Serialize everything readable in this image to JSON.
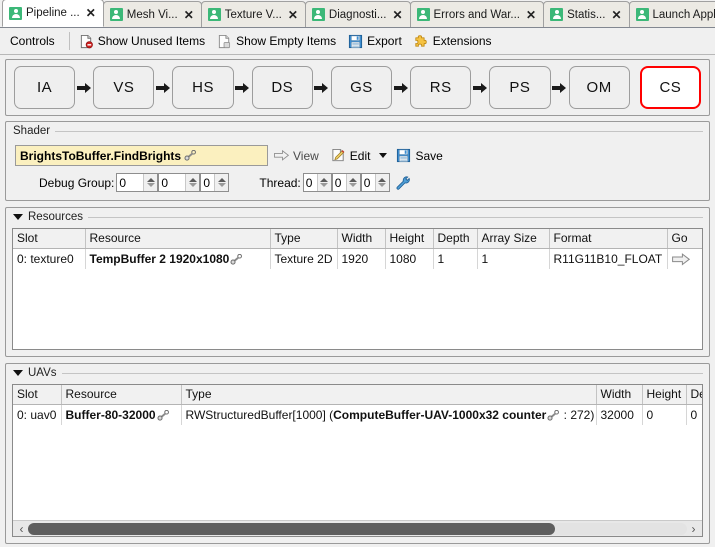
{
  "tabs": [
    {
      "label": "Pipeline ...",
      "icon": "renderdoc-tab-icon",
      "active": true
    },
    {
      "label": "Mesh Vi...",
      "icon": "renderdoc-tab-icon",
      "active": false
    },
    {
      "label": "Texture V...",
      "icon": "renderdoc-tab-icon",
      "active": false
    },
    {
      "label": "Diagnosti...",
      "icon": "renderdoc-tab-icon",
      "active": false
    },
    {
      "label": "Errors and War...",
      "icon": "renderdoc-tab-icon",
      "active": false
    },
    {
      "label": "Statis...",
      "icon": "renderdoc-tab-icon",
      "active": false
    },
    {
      "label": "Launch Appli...",
      "icon": "renderdoc-tab-icon",
      "active": false
    }
  ],
  "tab_close_glyph": "✕",
  "toolbar": {
    "controls_label": "Controls",
    "show_unused_label": "Show Unused Items",
    "show_empty_label": "Show Empty Items",
    "export_label": "Export",
    "extensions_label": "Extensions"
  },
  "pipeline": {
    "stages": [
      {
        "label": "IA",
        "selected": false
      },
      {
        "label": "VS",
        "selected": false
      },
      {
        "label": "HS",
        "selected": false
      },
      {
        "label": "DS",
        "selected": false
      },
      {
        "label": "GS",
        "selected": false
      },
      {
        "label": "RS",
        "selected": false
      },
      {
        "label": "PS",
        "selected": false
      },
      {
        "label": "OM",
        "selected": false
      },
      {
        "label": "CS",
        "selected": true
      }
    ],
    "selected_color": "#ff0000"
  },
  "shader": {
    "group_title": "Shader",
    "name": "BrightsToBuffer.FindBrights",
    "name_bg": "#fbf0bf",
    "view_label": "View",
    "edit_label": "Edit",
    "save_label": "Save",
    "debug_group_label": "Debug Group:",
    "debug_group": [
      "0",
      "0",
      "0"
    ],
    "thread_label": "Thread:",
    "thread": [
      "0",
      "0",
      "0"
    ]
  },
  "resources": {
    "group_title": "Resources",
    "columns": [
      "Slot",
      "Resource",
      "Type",
      "Width",
      "Height",
      "Depth",
      "Array Size",
      "Format",
      "Go"
    ],
    "rows": [
      {
        "slot": "0: texture0",
        "resource": "TempBuffer 2 1920x1080",
        "type": "Texture 2D",
        "width": "1920",
        "height": "1080",
        "depth": "1",
        "array_size": "1",
        "format": "R11G11B10_FLOAT",
        "go": "go-arrow-icon"
      }
    ]
  },
  "uavs": {
    "group_title": "UAVs",
    "columns": [
      "Slot",
      "Resource",
      "Type",
      "Width",
      "Height",
      "Dept"
    ],
    "rows": [
      {
        "slot": "0: uav0",
        "resource": "Buffer-80-32000",
        "type_prefix": "RWStructuredBuffer[1000] (",
        "type_bold": "ComputeBuffer-UAV-1000x32 counter",
        "type_suffix": " : 272)",
        "width": "32000",
        "height": "0",
        "depth": "0"
      }
    ],
    "scroll_left_glyph": "‹",
    "scroll_right_glyph": "›",
    "scroll_thumb_percent": 80
  }
}
